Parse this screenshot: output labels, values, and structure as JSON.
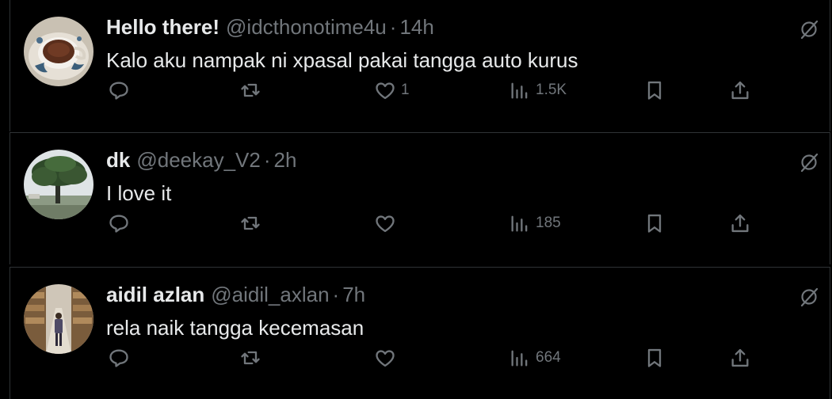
{
  "tweets": [
    {
      "display_name": "Hello there!",
      "handle": "@idcthonotime4u",
      "separator": "·",
      "time": "14h",
      "text": "Kalo aku nampak ni xpasal pakai tangga auto kurus",
      "reply_count": "",
      "retweet_count": "",
      "like_count": "1",
      "view_count": "1.5K",
      "avatar": "teacup-photo"
    },
    {
      "display_name": "dk",
      "handle": "@deekay_V2",
      "separator": "·",
      "time": "2h",
      "text": "I love it",
      "reply_count": "",
      "retweet_count": "",
      "like_count": "",
      "view_count": "185",
      "avatar": "tree-photo"
    },
    {
      "display_name": "aidil azlan",
      "handle": "@aidil_axlan",
      "separator": "·",
      "time": "7h",
      "text": "rela naik tangga kecemasan",
      "reply_count": "",
      "retweet_count": "",
      "like_count": "",
      "view_count": "664",
      "avatar": "warehouse-photo"
    }
  ],
  "icons": {
    "reply": "reply-icon",
    "retweet": "retweet-icon",
    "like": "heart-icon",
    "views": "views-chart-icon",
    "bookmark": "bookmark-icon",
    "share": "share-icon",
    "more": "grok-slash-icon"
  },
  "colors": {
    "background": "#000000",
    "text_primary": "#e7e9ea",
    "text_secondary": "#71767b",
    "divider": "#2f3336"
  }
}
